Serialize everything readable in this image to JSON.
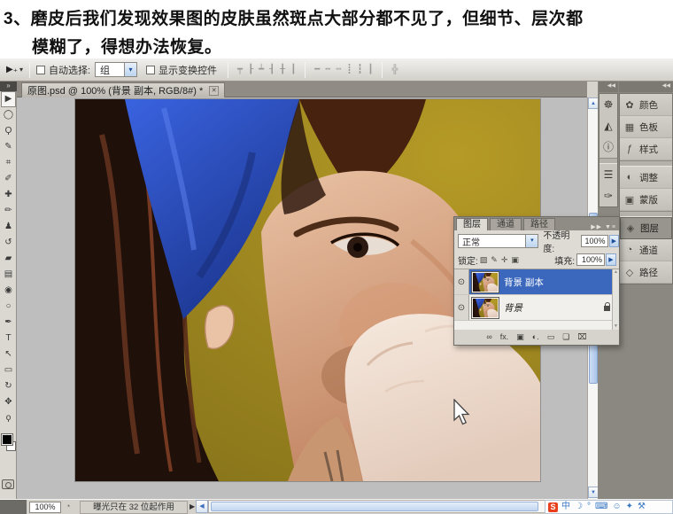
{
  "colors": {
    "selection_blue": "#3b67bd",
    "headband_blue": "#2b4ec9",
    "background_olive": "#a18a21",
    "pasteboard_gray": "#bebebe",
    "chrome_gray": "#d6d3cc"
  },
  "caption": {
    "line1": "3、磨皮后我们发现效果图的皮肤虽然斑点大部分都不见了，但细节、层次都",
    "line2": "模糊了，得想办法恢复。"
  },
  "options_bar": {
    "tool_icon": "▶₊",
    "tool_dropdown": "▾",
    "auto_select_label": "自动选择:",
    "auto_select_value": "组",
    "select_chevron": "▾",
    "show_transform_label": "显示变换控件",
    "align_icons": [
      "┯",
      "┠",
      "┷",
      "┨",
      "╂",
      "┃"
    ],
    "distribute_icons": [
      "━",
      "┅",
      "┉",
      "┋",
      "┇",
      "┃"
    ],
    "auto_align_icon": "╬"
  },
  "toolbar": {
    "expander": "»",
    "tools": [
      {
        "name": "move-tool",
        "glyph": "▶",
        "selected": true
      },
      {
        "name": "marquee-tool",
        "glyph": "◯",
        "selected": false
      },
      {
        "name": "lasso-tool",
        "glyph": "Ϙ",
        "selected": false
      },
      {
        "name": "quick-selection-tool",
        "glyph": "✎",
        "selected": false
      },
      {
        "name": "crop-tool",
        "glyph": "⌗",
        "selected": false
      },
      {
        "name": "eyedropper-tool",
        "glyph": "✐",
        "selected": false
      },
      {
        "name": "healing-brush-tool",
        "glyph": "✚",
        "selected": false
      },
      {
        "name": "brush-tool",
        "glyph": "✏",
        "selected": false
      },
      {
        "name": "clone-stamp-tool",
        "glyph": "♟",
        "selected": false
      },
      {
        "name": "history-brush-tool",
        "glyph": "↺",
        "selected": false
      },
      {
        "name": "eraser-tool",
        "glyph": "▰",
        "selected": false
      },
      {
        "name": "gradient-tool",
        "glyph": "▤",
        "selected": false
      },
      {
        "name": "blur-tool",
        "glyph": "◉",
        "selected": false
      },
      {
        "name": "dodge-tool",
        "glyph": "○",
        "selected": false
      },
      {
        "name": "pen-tool",
        "glyph": "✒",
        "selected": false
      },
      {
        "name": "type-tool",
        "glyph": "T",
        "selected": false
      },
      {
        "name": "path-selection-tool",
        "glyph": "↖",
        "selected": false
      },
      {
        "name": "shape-tool",
        "glyph": "▭",
        "selected": false
      },
      {
        "name": "rotate-3d-tool",
        "glyph": "↻",
        "selected": false
      },
      {
        "name": "hand-tool",
        "glyph": "✥",
        "selected": false
      },
      {
        "name": "zoom-tool",
        "glyph": "ϙ",
        "selected": false
      }
    ]
  },
  "document": {
    "tab_title": "原图.psd @ 100% (背景 副本, RGB/8#) *",
    "close_glyph": "✕"
  },
  "scrollbars": {
    "up": "▲",
    "down": "▼",
    "left": "◀",
    "right": "▶"
  },
  "layers_panel": {
    "tabs": [
      {
        "label": "图层",
        "active": true
      },
      {
        "label": "通道",
        "active": false
      },
      {
        "label": "路径",
        "active": false
      }
    ],
    "header_arrows": "▶▶",
    "menu_icon": "▼≡",
    "blend_mode_value": "正常",
    "opacity_label": "不透明度:",
    "opacity_value": "100%",
    "lock_label": "锁定:",
    "lock_icons": [
      {
        "name": "lock-transparent-pixels-icon",
        "glyph": "▨"
      },
      {
        "name": "lock-image-pixels-icon",
        "glyph": "✎"
      },
      {
        "name": "lock-position-icon",
        "glyph": "✛"
      },
      {
        "name": "lock-all-icon",
        "glyph": "▣"
      }
    ],
    "fill_label": "填充:",
    "fill_value": "100%",
    "eye_glyph": "⊙",
    "layers": [
      {
        "name": "背景 副本",
        "selected": true,
        "locked": false
      },
      {
        "name": "背景",
        "selected": false,
        "locked": true
      }
    ],
    "bottom_icons": [
      {
        "name": "link-layers-icon",
        "glyph": "∞"
      },
      {
        "name": "layer-style-icon",
        "glyph": "fx."
      },
      {
        "name": "add-layer-mask-icon",
        "glyph": "▣"
      },
      {
        "name": "adjustment-layer-icon",
        "glyph": "◐."
      },
      {
        "name": "new-group-icon",
        "glyph": "▭"
      },
      {
        "name": "new-layer-icon",
        "glyph": "❏"
      },
      {
        "name": "delete-layer-icon",
        "glyph": "⌧"
      }
    ]
  },
  "dock": {
    "collapse_glyph": "◀◀",
    "icon_column": [
      {
        "name": "navigator-panel-icon",
        "glyph": "☸",
        "group": 1
      },
      {
        "name": "histogram-panel-icon",
        "glyph": "◭",
        "group": 1
      },
      {
        "name": "info-panel-icon",
        "glyph": "ⓘ",
        "group": 1
      },
      {
        "name": "clone-source-panel-icon",
        "glyph": "☰",
        "group": 2
      },
      {
        "name": "brushes-panel-icon",
        "glyph": "✑",
        "group": 2
      }
    ],
    "label_column": [
      {
        "name": "panel-button-color",
        "label": "颜色",
        "glyph": "✿",
        "group": 1,
        "active": false
      },
      {
        "name": "panel-button-swatches",
        "label": "色板",
        "glyph": "▦",
        "group": 1,
        "active": false
      },
      {
        "name": "panel-button-styles",
        "label": "样式",
        "glyph": "ƒ",
        "group": 1,
        "active": false
      },
      {
        "name": "panel-button-adjustments",
        "label": "调整",
        "glyph": "◐",
        "group": 2,
        "active": false
      },
      {
        "name": "panel-button-masks",
        "label": "蒙版",
        "glyph": "▣",
        "group": 2,
        "active": false
      },
      {
        "name": "panel-button-layers",
        "label": "图层",
        "glyph": "◈",
        "group": 3,
        "active": true
      },
      {
        "name": "panel-button-channels",
        "label": "通道",
        "glyph": "◔",
        "group": 3,
        "active": false
      },
      {
        "name": "panel-button-paths",
        "label": "路径",
        "glyph": "◇",
        "group": 3,
        "active": false
      }
    ]
  },
  "status_bar": {
    "zoom_value": "100%",
    "doc_info_icon": "◔",
    "message": "曝光只在 32 位起作用",
    "expand_arrow": "▶"
  },
  "ime_bar": {
    "logo": "S",
    "items": [
      {
        "name": "ime-chinese-mode-icon",
        "glyph": "中"
      },
      {
        "name": "ime-moon-icon",
        "glyph": "☽"
      },
      {
        "name": "ime-punctuation-icon",
        "glyph": "°"
      },
      {
        "name": "ime-keyboard-icon",
        "glyph": "⌨"
      },
      {
        "name": "ime-person-icon",
        "glyph": "☺"
      },
      {
        "name": "ime-skin-icon",
        "glyph": "✦"
      },
      {
        "name": "ime-toolbox-icon",
        "glyph": "⚒"
      }
    ]
  }
}
